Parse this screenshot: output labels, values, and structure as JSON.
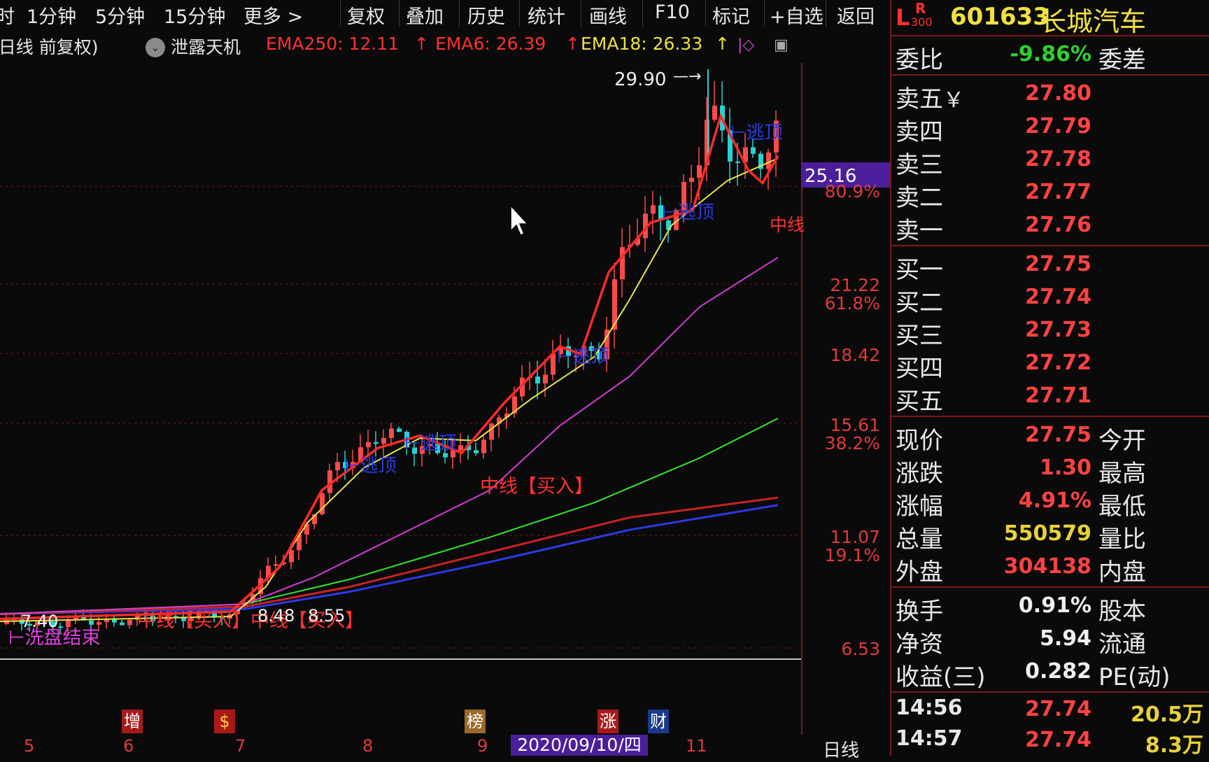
{
  "toolbar": {
    "items": [
      "时",
      "1分钟",
      "5分钟",
      "15分钟",
      "更多 >",
      "复权",
      "叠加",
      "历史",
      "统计",
      "画线",
      "F10",
      "标记",
      "+自选",
      "返回"
    ]
  },
  "indicators": {
    "period_label": "(日线 前复权)",
    "strategy": "泄露天机",
    "ema250": "EMA250: 12.11",
    "ema6": "EMA6: 26.39",
    "ema18": "EMA18: 26.33",
    "arrow": "↑"
  },
  "chart": {
    "high_label": "29.90",
    "low_labels": [
      "7.40",
      "8.48",
      "8.55"
    ],
    "cursor_price": "25.16",
    "price_ticks": [
      "21.22",
      "18.42",
      "15.61",
      "11.07",
      "6.53"
    ],
    "fib_ticks": [
      "80.9%",
      "61.8%",
      "38.2%",
      "19.1%"
    ],
    "signals": {
      "escape_top": "逃顶",
      "buy_mid": "中线【买入】",
      "buy_mid_2": "中线【买入】中线【买入】",
      "wash_end": "洗盘结束",
      "mid_cut": "中线"
    },
    "event_tags": [
      "增",
      "$",
      "榜",
      "涨",
      "财"
    ],
    "x_labels": [
      "5",
      "6",
      "7",
      "8",
      "9",
      "11"
    ],
    "selected_date": "2020/09/10/四",
    "period_button": "日线",
    "colors": {
      "up": "#ff4a4a",
      "down": "#27d3d3",
      "ema6": "#ff2a2a",
      "ema18": "#e6e64a",
      "ma_purple": "#d43ad4",
      "ma_green": "#2ee82e",
      "ma_red": "#c82222",
      "ma_blue": "#2a3ae6"
    }
  },
  "chart_data": {
    "type": "line",
    "title": "",
    "xlabel": "",
    "ylabel": "",
    "ylim": [
      6.53,
      29.9
    ],
    "x": [
      "5",
      "6",
      "7",
      "8",
      "9",
      "2020/09/10/四",
      "11"
    ],
    "series": [
      {
        "name": "EMA6",
        "values": [
          7.6,
          7.7,
          8.5,
          14.0,
          15.3,
          18.6,
          27.0
        ]
      },
      {
        "name": "EMA18",
        "values": [
          7.7,
          7.8,
          8.3,
          12.8,
          15.2,
          18.0,
          26.3
        ]
      },
      {
        "name": "EMA250",
        "values": [
          7.9,
          7.9,
          8.1,
          8.4,
          9.0,
          10.0,
          12.1
        ]
      }
    ]
  },
  "panel": {
    "header": {
      "l": "L",
      "r_top": "R",
      "r_bottom": "300",
      "code": "601633",
      "name": "长城汽车"
    },
    "weibi": {
      "label": "委比",
      "value": "-9.86%",
      "label2": "委差"
    },
    "asks": [
      {
        "label": "卖五",
        "value": "27.80",
        "mark": "￥"
      },
      {
        "label": "卖四",
        "value": "27.79"
      },
      {
        "label": "卖三",
        "value": "27.78"
      },
      {
        "label": "卖二",
        "value": "27.77"
      },
      {
        "label": "卖一",
        "value": "27.76"
      }
    ],
    "bids": [
      {
        "label": "买一",
        "value": "27.75"
      },
      {
        "label": "买二",
        "value": "27.74"
      },
      {
        "label": "买三",
        "value": "27.73"
      },
      {
        "label": "买四",
        "value": "27.72"
      },
      {
        "label": "买五",
        "value": "27.71"
      }
    ],
    "quote": [
      {
        "label": "现价",
        "value": "27.75",
        "label2": "今开",
        "color": "red"
      },
      {
        "label": "涨跌",
        "value": "1.30",
        "label2": "最高",
        "color": "red"
      },
      {
        "label": "涨幅",
        "value": "4.91%",
        "label2": "最低",
        "color": "red"
      },
      {
        "label": "总量",
        "value": "550579",
        "label2": "量比",
        "color": "yellow"
      },
      {
        "label": "外盘",
        "value": "304138",
        "label2": "内盘",
        "color": "red"
      }
    ],
    "fundamentals": [
      {
        "label": "换手",
        "value": "0.91%",
        "label2": "股本"
      },
      {
        "label": "净资",
        "value": "5.94",
        "label2": "流通"
      },
      {
        "label": "收益(三)",
        "value": "0.282",
        "label2": "PE(动)"
      }
    ],
    "ticks": [
      {
        "time": "14:56",
        "price": "27.74",
        "vol": "20.5万"
      },
      {
        "time": "14:57",
        "price": "27.74",
        "vol": "8.3万"
      }
    ]
  }
}
